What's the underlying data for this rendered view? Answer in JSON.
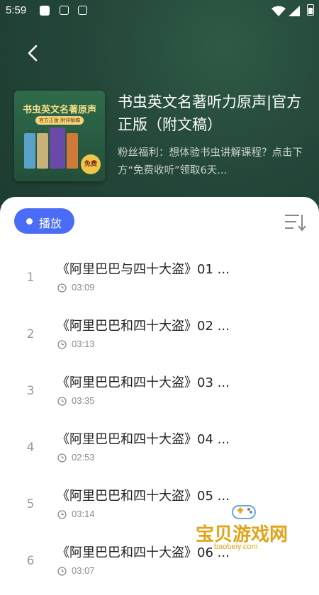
{
  "status_bar": {
    "time": "5:59"
  },
  "album": {
    "cover_title": "书虫英文名著原声",
    "cover_subtitle": "官方正版 附详解稿",
    "cover_badge": "免费",
    "title": "书虫英文名著听力原声|官方正版（附文稿）",
    "description": "粉丝福利：想体验书虫讲解课程？点击下方“免费收听”领取6天..."
  },
  "controls": {
    "play_label": "播放"
  },
  "tracks": [
    {
      "index": "1",
      "title": "《阿里巴巴与四十大盗》01 ...",
      "duration": "03:09"
    },
    {
      "index": "2",
      "title": "《阿里巴巴和四十大盗》02 ...",
      "duration": "03:13"
    },
    {
      "index": "3",
      "title": "《阿里巴巴和四十大盗》03 ...",
      "duration": "03:35"
    },
    {
      "index": "4",
      "title": "《阿里巴巴和四十大盗》04 ...",
      "duration": "02:53"
    },
    {
      "index": "5",
      "title": "《阿里巴巴和四十大盗》05 ...",
      "duration": "03:14"
    },
    {
      "index": "6",
      "title": "《阿里巴巴和四十大盗》06 ...",
      "duration": "03:07"
    }
  ],
  "watermark": {
    "text": "宝贝游戏网",
    "url": "baobeiy.com"
  },
  "colors": {
    "header_bg": "#24473a",
    "accent": "#4a6cf7",
    "watermark": "#e0a418"
  }
}
